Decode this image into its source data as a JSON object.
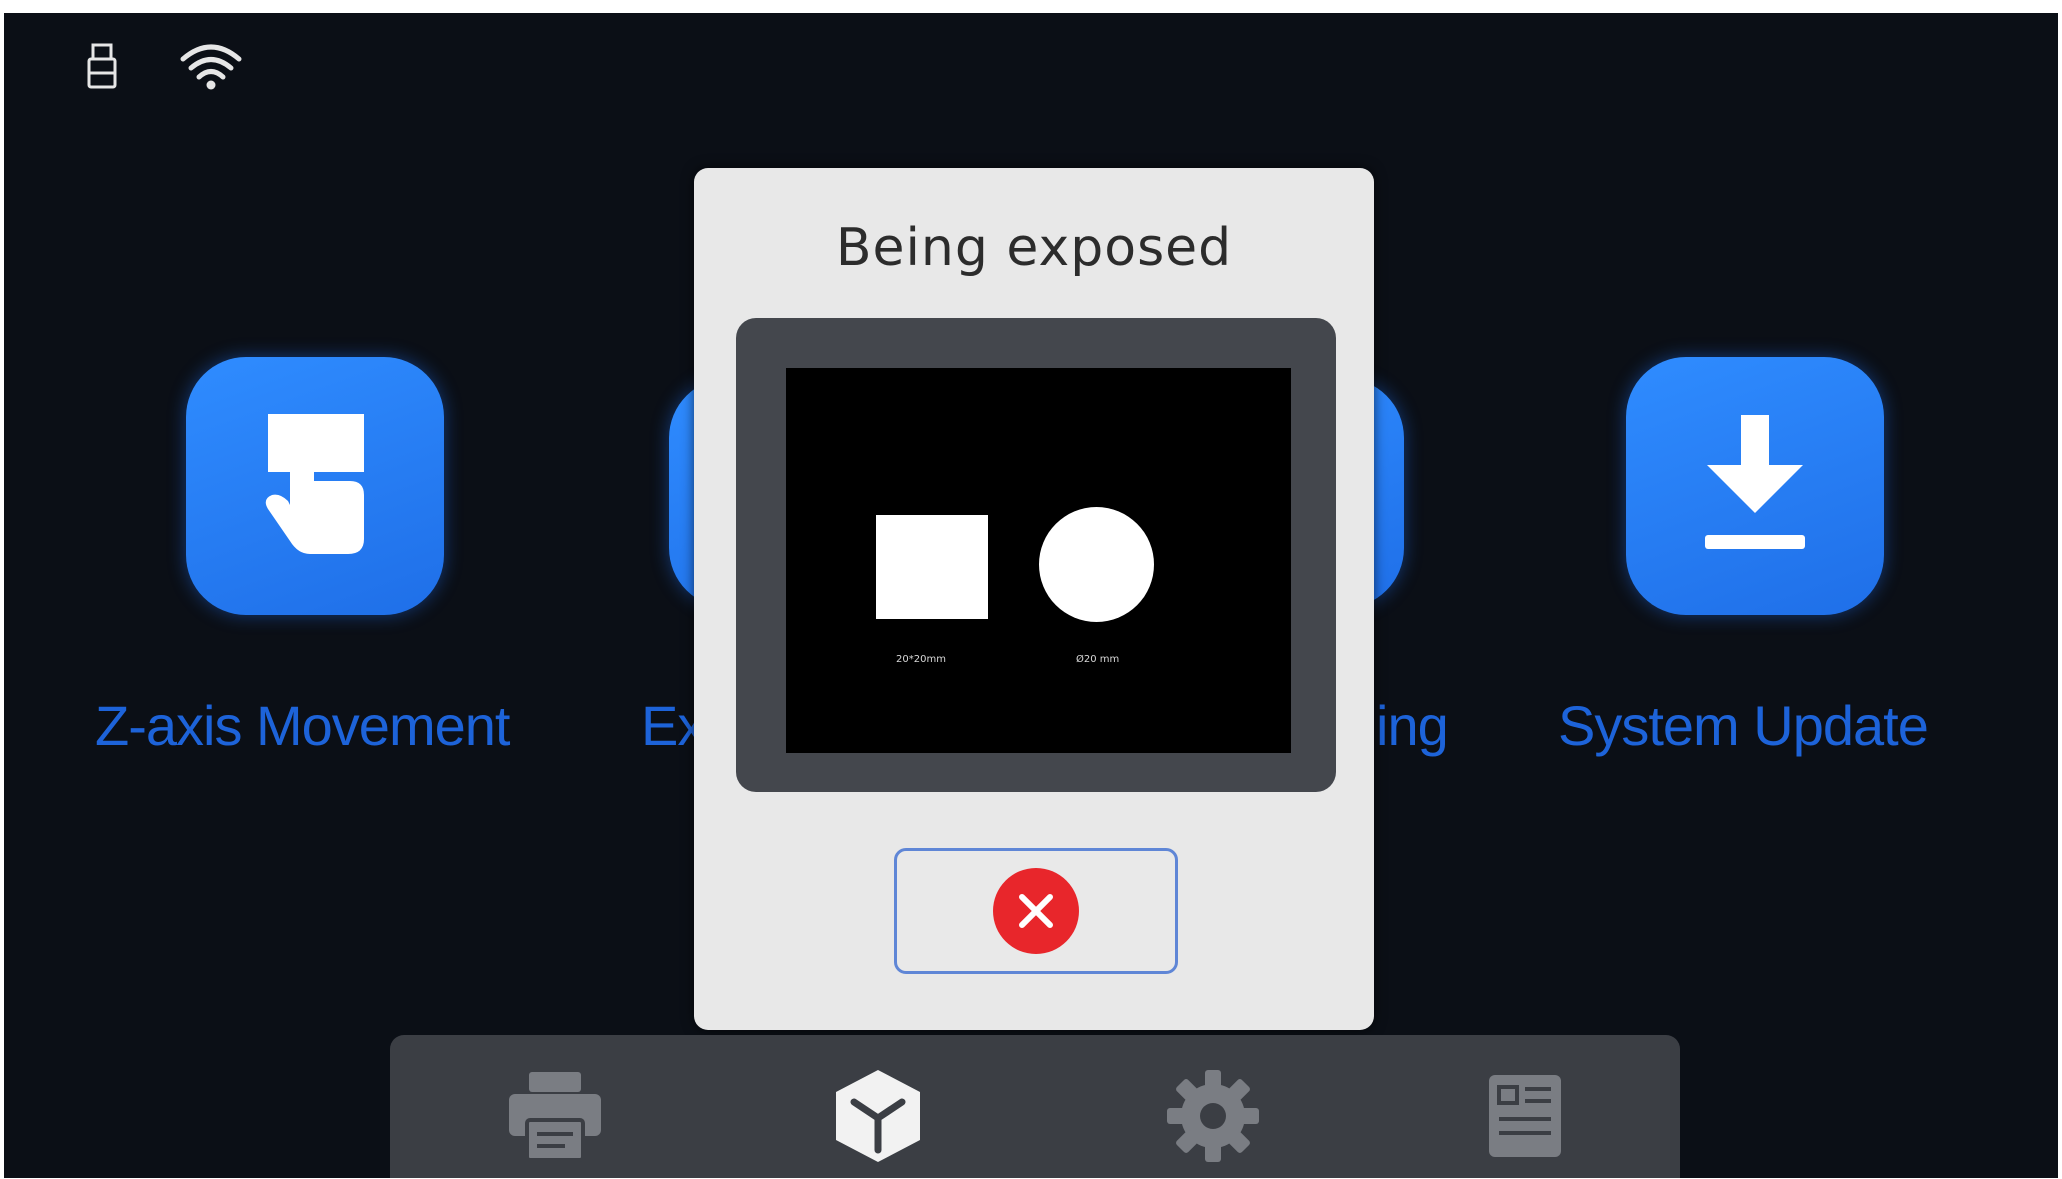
{
  "dialog": {
    "title": "Being exposed",
    "preview": {
      "square_caption": "20*20mm",
      "circle_caption": "Ø20 mm"
    }
  },
  "tiles": [
    {
      "label": "Z-axis Movement",
      "icon": "hand-pointer-icon"
    },
    {
      "label": "Ex",
      "icon": "partially-hidden-tile"
    },
    {
      "label": "ing",
      "icon": "partially-hidden-tile"
    },
    {
      "label": "System Update",
      "icon": "download-icon"
    }
  ],
  "status": {
    "icons": [
      "usb-icon",
      "wifi-icon"
    ]
  },
  "nav": {
    "items": [
      "print-icon",
      "model-cube-icon",
      "settings-gear-icon",
      "info-document-icon"
    ]
  },
  "colors": {
    "background": "#0b0f16",
    "tile_blue": "#2f8cff",
    "label_blue": "#1d63d9",
    "dialog_bg": "#e8e8e8",
    "close_red": "#e8262b",
    "nav_bg": "#3b3e44"
  }
}
